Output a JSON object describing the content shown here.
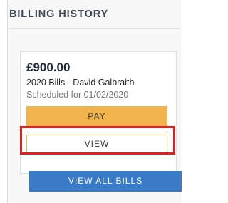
{
  "billing_history": {
    "title": "BILLING HISTORY",
    "bill": {
      "amount": "£900.00",
      "name": "2020 Bills - David Galbraith",
      "scheduled": "Scheduled for 01/02/2020",
      "pay_label": "PAY",
      "view_label": "VIEW"
    },
    "view_all_label": "VIEW ALL BILLS"
  },
  "colors": {
    "pay_button": "#f1b44c",
    "view_all_button": "#3a7bc8",
    "highlight": "#e02020"
  }
}
